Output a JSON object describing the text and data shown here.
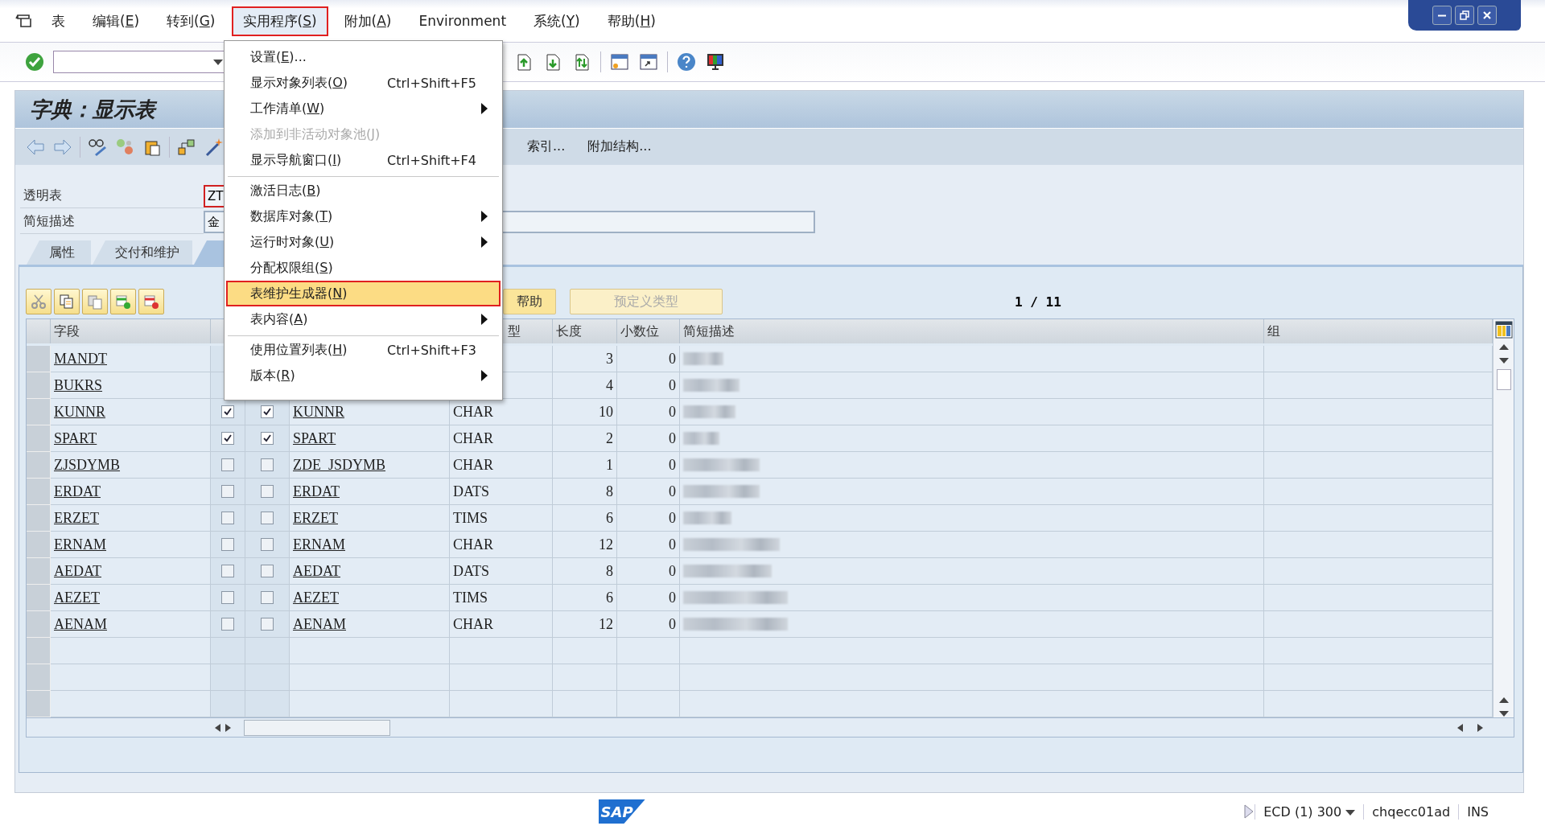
{
  "menu_bar": {
    "items": [
      {
        "label": "表",
        "selected": false
      },
      {
        "label": "编辑(E)",
        "selected": false
      },
      {
        "label": "转到(G)",
        "selected": false
      },
      {
        "label": "实用程序(S)",
        "selected": true
      },
      {
        "label": "附加(A)",
        "selected": false
      },
      {
        "label": "Environment",
        "selected": false
      },
      {
        "label": "系统(Y)",
        "selected": false
      },
      {
        "label": "帮助(H)",
        "selected": false
      }
    ]
  },
  "dropdown": {
    "items": [
      {
        "label": "设置(E)...",
        "disabled": false,
        "selected": false,
        "submenu": false,
        "separator_before": false
      },
      {
        "label": "显示对象列表(O)",
        "shortcut": "Ctrl+Shift+F5",
        "disabled": false,
        "selected": false,
        "submenu": false,
        "separator_before": false
      },
      {
        "label": "工作清单(W)",
        "disabled": false,
        "selected": false,
        "submenu": true,
        "separator_before": false
      },
      {
        "label": "添加到非活动对象池(J)",
        "disabled": true,
        "selected": false,
        "submenu": false,
        "separator_before": false
      },
      {
        "label": "显示导航窗口(I)",
        "shortcut": "Ctrl+Shift+F4",
        "disabled": false,
        "selected": false,
        "submenu": false,
        "separator_before": false
      },
      {
        "label": "激活日志(B)",
        "disabled": false,
        "selected": false,
        "submenu": false,
        "separator_before": true
      },
      {
        "label": "数据库对象(T)",
        "disabled": false,
        "selected": false,
        "submenu": true,
        "separator_before": false
      },
      {
        "label": "运行时对象(U)",
        "disabled": false,
        "selected": false,
        "submenu": true,
        "separator_before": false
      },
      {
        "label": "分配权限组(S)",
        "disabled": false,
        "selected": false,
        "submenu": false,
        "separator_before": false
      },
      {
        "label": "表维护生成器(N)",
        "disabled": false,
        "selected": true,
        "submenu": false,
        "separator_before": false
      },
      {
        "label": "表内容(A)",
        "disabled": false,
        "selected": false,
        "submenu": true,
        "separator_before": false
      },
      {
        "label": "使用位置列表(H)",
        "shortcut": "Ctrl+Shift+F3",
        "disabled": false,
        "selected": false,
        "submenu": false,
        "separator_before": true
      },
      {
        "label": "版本(R)",
        "disabled": false,
        "selected": false,
        "submenu": true,
        "separator_before": false
      }
    ]
  },
  "title": "字典：显示表",
  "app_toolbar": {
    "buttons": [
      "索引...",
      "附加结构..."
    ]
  },
  "fields": [
    {
      "label": "透明表",
      "value": "ZT",
      "focused": true
    },
    {
      "label": "简短描述",
      "value": "金",
      "focused": false
    }
  ],
  "tabs": [
    {
      "label": "属性",
      "selected": false
    },
    {
      "label": "交付和维护",
      "selected": false
    },
    {
      "selected": true
    }
  ],
  "table_toolbar": {
    "buttons": [
      {
        "label": "帮助",
        "disabled": false
      },
      {
        "label": "预定义类型",
        "disabled": true
      }
    ]
  },
  "page_counter": {
    "current": "1",
    "separator": "/",
    "total": "11"
  },
  "table": {
    "columns": {
      "field": "字段",
      "data_type": "型",
      "length": "长度",
      "decimals": "小数位",
      "description": "简短描述",
      "group": "组"
    },
    "rows": [
      {
        "field": "MANDT",
        "length": "3",
        "decimals": "0",
        "description_redacted": true
      },
      {
        "field": "BUKRS",
        "length": "4",
        "decimals": "0",
        "description_redacted": true
      },
      {
        "field": "KUNNR",
        "key": true,
        "initial": true,
        "data_element": "KUNNR",
        "data_type": "CHAR",
        "length": "10",
        "decimals": "0",
        "description_redacted": true
      },
      {
        "field": "SPART",
        "key": true,
        "initial": true,
        "data_element": "SPART",
        "data_type": "CHAR",
        "length": "2",
        "decimals": "0",
        "description_redacted": true
      },
      {
        "field": "ZJSDYMB",
        "key": false,
        "initial": false,
        "data_element": "ZDE_JSDYMB",
        "data_type": "CHAR",
        "length": "1",
        "decimals": "0",
        "description_redacted": true
      },
      {
        "field": "ERDAT",
        "key": false,
        "initial": false,
        "data_element": "ERDAT",
        "data_type": "DATS",
        "length": "8",
        "decimals": "0",
        "description_redacted": true
      },
      {
        "field": "ERZET",
        "key": false,
        "initial": false,
        "data_element": "ERZET",
        "data_type": "TIMS",
        "length": "6",
        "decimals": "0",
        "description_redacted": true
      },
      {
        "field": "ERNAM",
        "key": false,
        "initial": false,
        "data_element": "ERNAM",
        "data_type": "CHAR",
        "length": "12",
        "decimals": "0",
        "description_redacted": true
      },
      {
        "field": "AEDAT",
        "key": false,
        "initial": false,
        "data_element": "AEDAT",
        "data_type": "DATS",
        "length": "8",
        "decimals": "0",
        "description_redacted": true
      },
      {
        "field": "AEZET",
        "key": false,
        "initial": false,
        "data_element": "AEZET",
        "data_type": "TIMS",
        "length": "6",
        "decimals": "0",
        "description_redacted": true
      },
      {
        "field": "AENAM",
        "key": false,
        "initial": false,
        "data_element": "AENAM",
        "data_type": "CHAR",
        "length": "12",
        "decimals": "0",
        "description_redacted": true
      }
    ]
  },
  "status_bar": {
    "logo": "SAP",
    "system": "ECD (1) 300",
    "server": "chqecc01ad",
    "mode": "INS"
  }
}
